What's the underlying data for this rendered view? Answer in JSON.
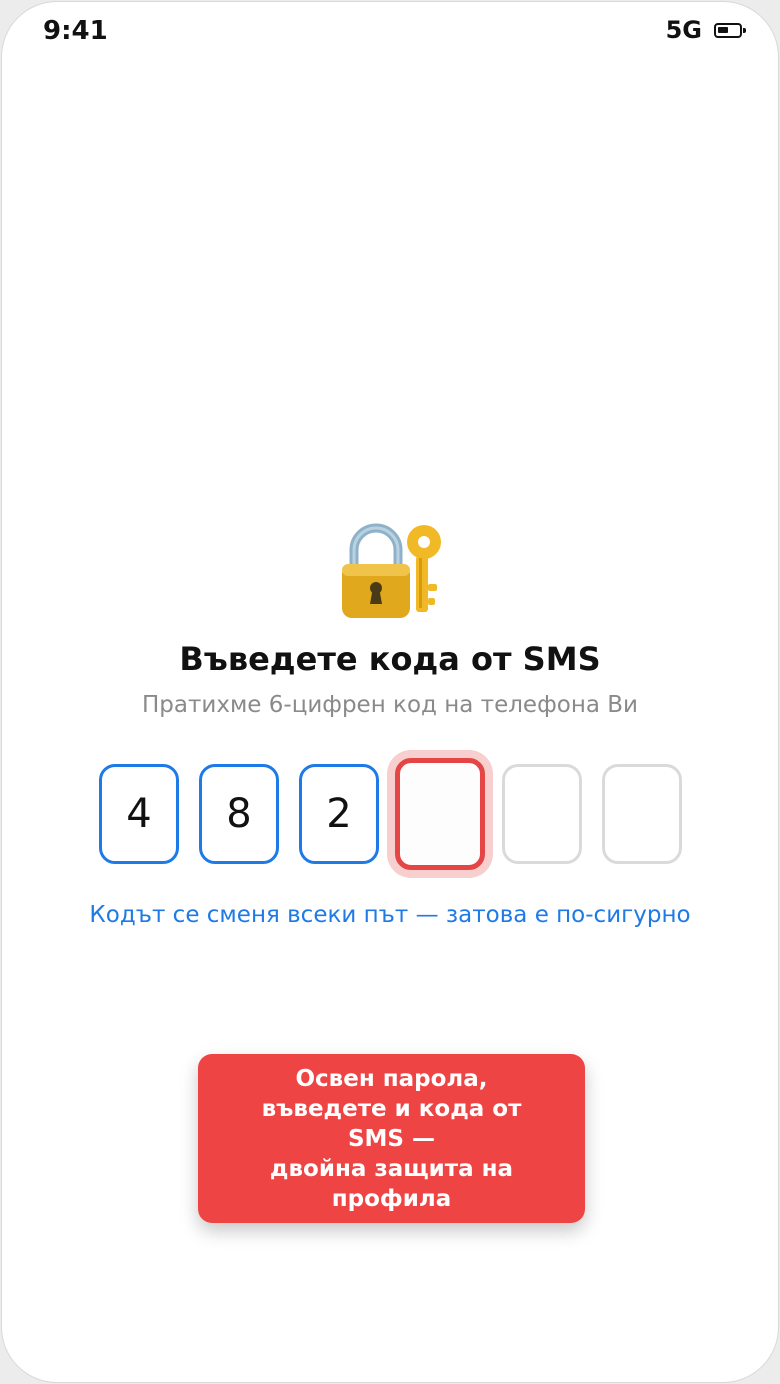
{
  "status_bar": {
    "time": "9:41",
    "network": "5G",
    "battery_icon": "battery-icon",
    "battery_level": 0.55
  },
  "illustration": {
    "icon": "lock-with-key-icon"
  },
  "screen": {
    "title": "Въведете кода от SMS",
    "subtitle": "Пратихме 6-цифрен код на телефона Ви",
    "hint_link": "Кодът се сменя всеки път — затова е по-сигурно"
  },
  "otp": {
    "length": 6,
    "digits": [
      "4",
      "8",
      "2",
      "",
      "",
      ""
    ],
    "active_index": 3
  },
  "tooltip": {
    "text": "Освен парола,\nвъведете и кода от\nSMS —\nдвойна защита на\nпрофила"
  },
  "colors": {
    "accent": "#1e7ae6",
    "error": "#ef4444",
    "focus_ring": "#f7cfcf",
    "muted_text": "#8a8a8a"
  }
}
